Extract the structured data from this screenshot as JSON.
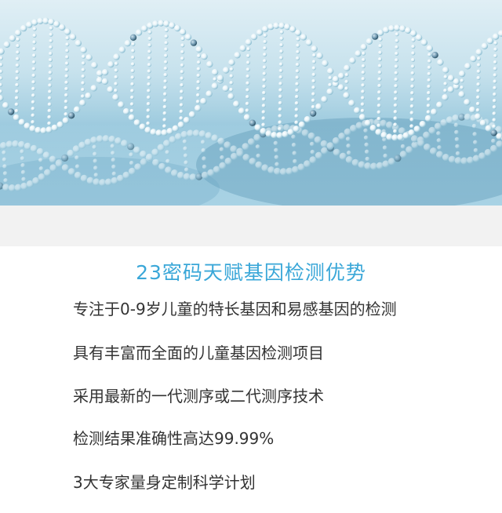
{
  "section": {
    "title": "23密码天赋基因检测优势",
    "title_color": "#3aa7d8"
  },
  "features": [
    "专注于0-9岁儿童的特长基因和易感基因的检测",
    "具有丰富而全面的儿童基因检测项目",
    "采用最新的一代测序或二代测序技术",
    "检测结果准确性高达99.99%",
    "3大专家量身定制科学计划"
  ],
  "hero": {
    "image": "dna-double-helix-banner"
  }
}
